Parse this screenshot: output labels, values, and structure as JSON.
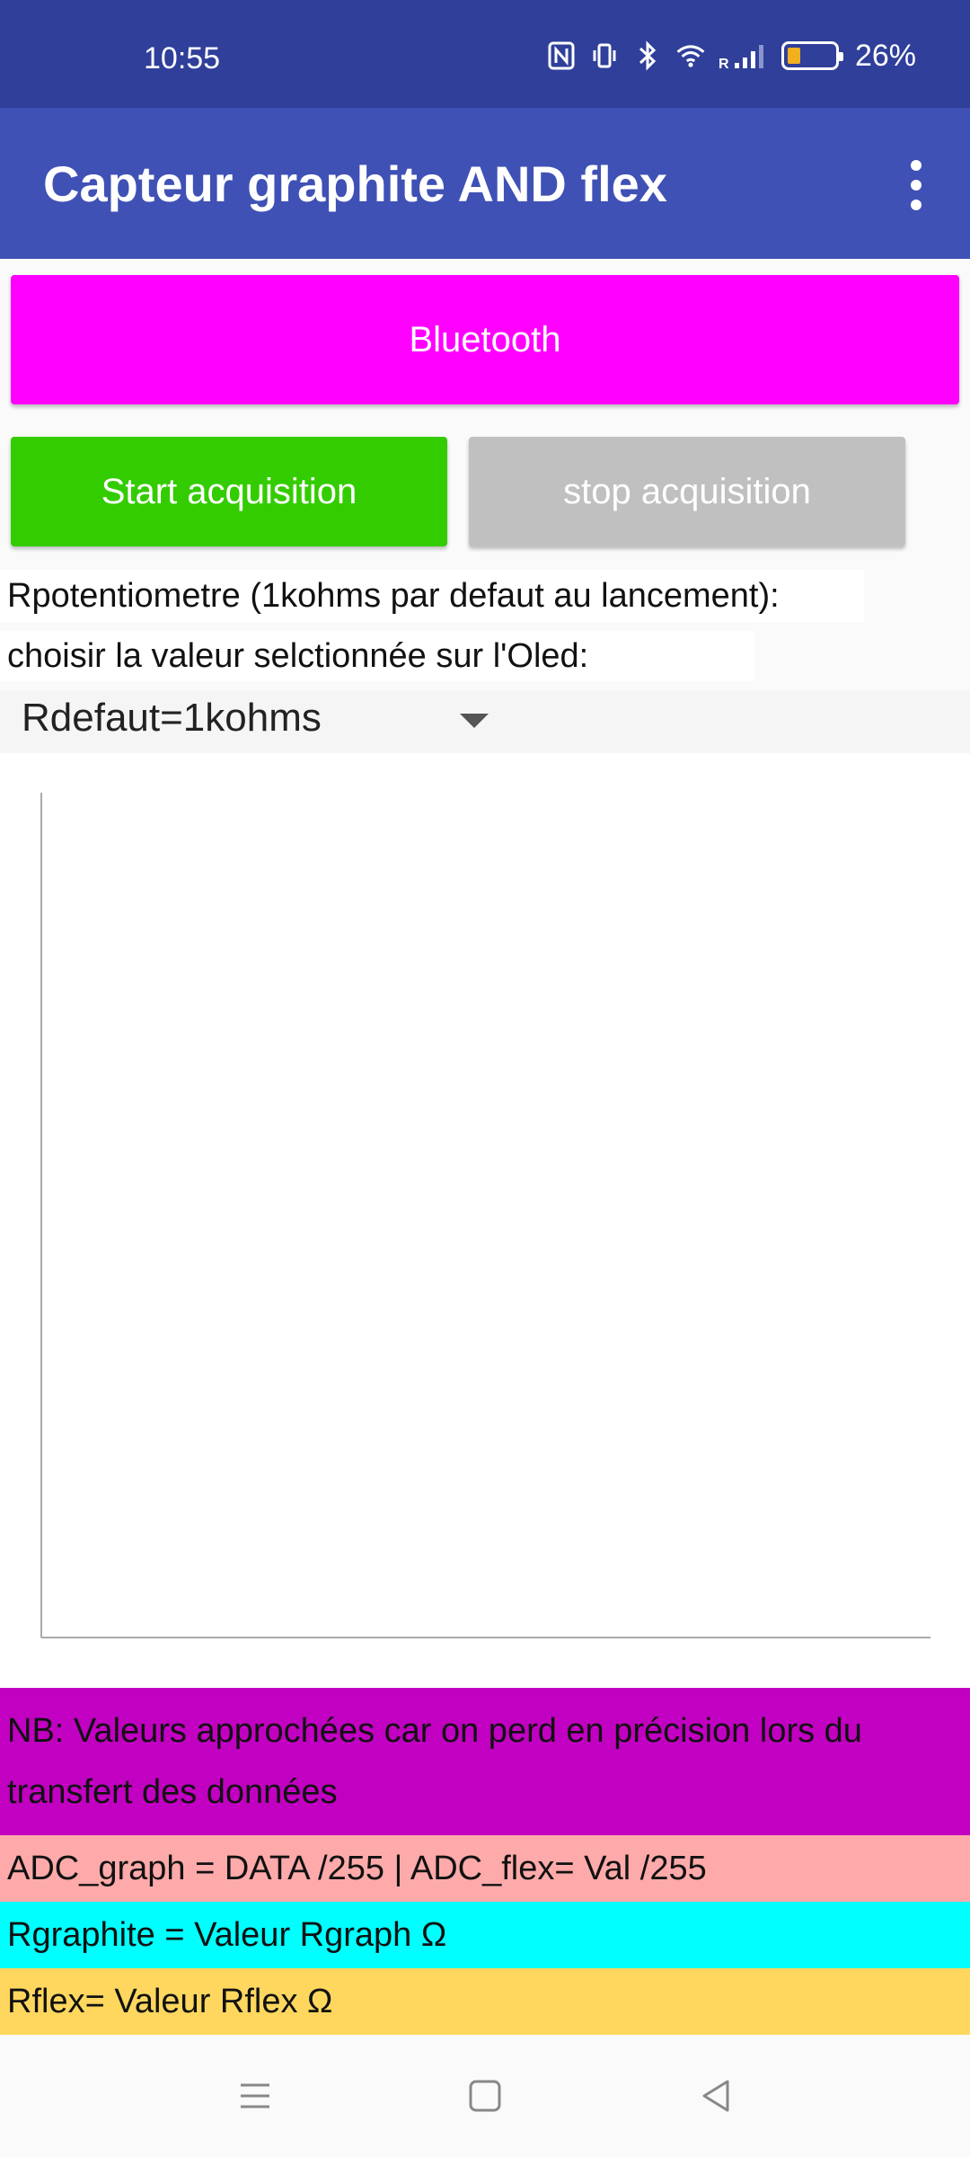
{
  "status_bar": {
    "time": "10:55",
    "battery": "26%",
    "battery_level": 0.26,
    "icons": [
      "nfc-icon",
      "vibrate-icon",
      "bluetooth-icon",
      "wifi-icon",
      "signal-icon",
      "battery-icon"
    ]
  },
  "app_bar": {
    "title": "Capteur graphite AND flex",
    "menu_icon": "more-vert-icon"
  },
  "buttons": {
    "bluetooth": "Bluetooth",
    "start": "Start acquisition",
    "stop": "stop acquisition"
  },
  "labels": {
    "rpot": "Rpotentiometre (1kohms par defaut au lancement):",
    "choose": "choisir la valeur selctionnée sur l'Oled:"
  },
  "spinner": {
    "selected": "Rdefaut=1kohms"
  },
  "info": {
    "nb": "NB: Valeurs approchées car on perd en précision lors du transfert des données",
    "adc": "ADC_graph = DATA /255  |  ADC_flex= Val /255",
    "rgraphite": "Rgraphite = Valeur Rgraph Ω",
    "rflex": "Rflex=  Valeur Rflex Ω"
  },
  "colors": {
    "status_bar": "#2f3f9a",
    "app_bar": "#3f51b5",
    "bluetooth_button": "#ff00ff",
    "start_button": "#33cc00",
    "stop_button": "#c0c0c0",
    "nb_band": "#c200c2",
    "adc_band": "#ffaaaa",
    "rgraphite_band": "#00ffff",
    "rflex_band": "#ffd75e"
  },
  "nav_bar": {
    "icons": [
      "menu-icon",
      "home-icon",
      "back-icon"
    ]
  }
}
